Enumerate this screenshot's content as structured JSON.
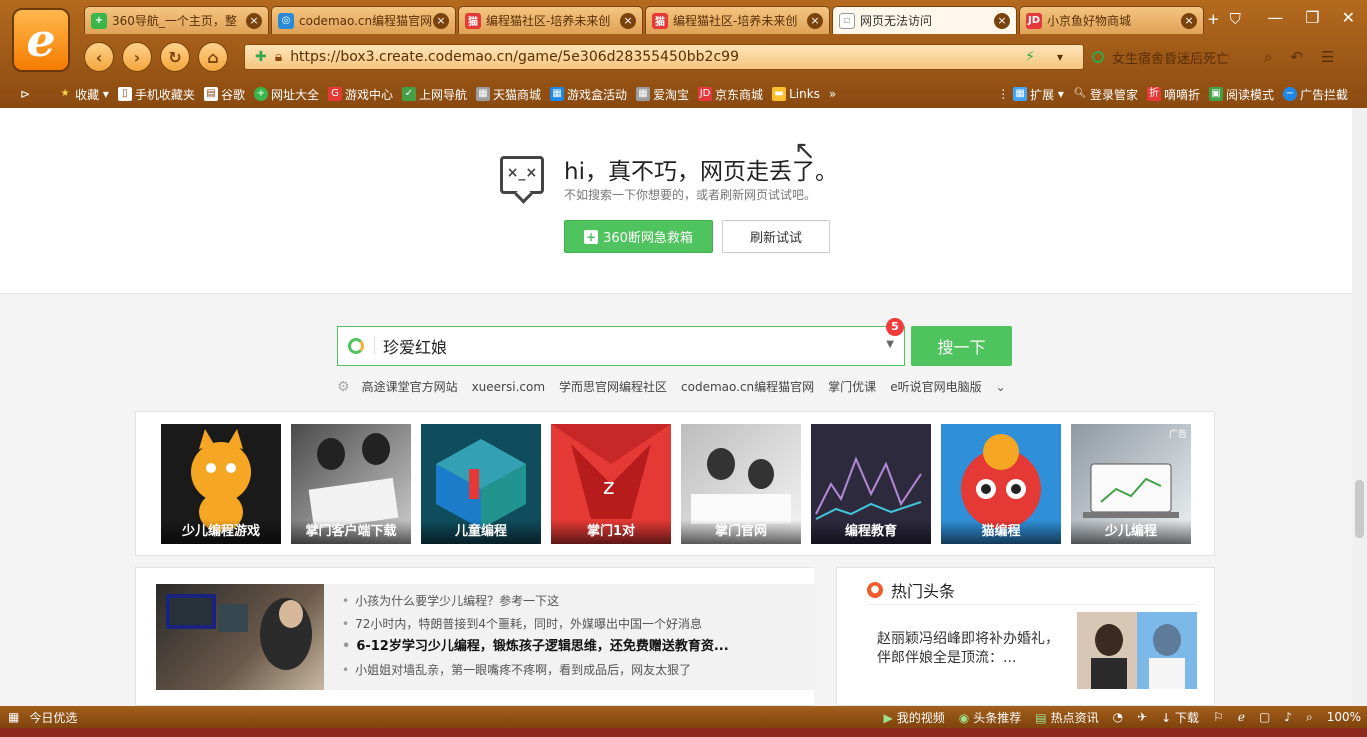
{
  "tabs": [
    {
      "title": "360导航_一个主页，整",
      "icon": "360-icon",
      "color": "#3ab54a"
    },
    {
      "title": "codemao.cn编程猫官网",
      "icon": "globe-icon",
      "color": "#2b8ad8"
    },
    {
      "title": "编程猫社区-培养未来创",
      "icon": "codemao-icon",
      "color": "#e53935"
    },
    {
      "title": "编程猫社区-培养未来创",
      "icon": "codemao-icon",
      "color": "#e53935"
    },
    {
      "title": "网页无法访问",
      "icon": "page-icon",
      "color": "#999999"
    },
    {
      "title": "小京鱼好物商城",
      "icon": "jd-icon",
      "color": "#e4393c"
    }
  ],
  "address": {
    "url": "https://box3.create.codemao.cn/game/5e306d28355450bb2c99",
    "search_hint": "女生宿舍昏迷后死亡"
  },
  "bookmarks": {
    "items": [
      "收藏",
      "手机收藏夹",
      "谷歌",
      "网址大全",
      "游戏中心",
      "上网导航",
      "天猫商城",
      "游戏盒活动",
      "爱淘宝",
      "京东商城",
      "Links"
    ],
    "right": [
      "扩展",
      "登录管家",
      "嘀嘀折",
      "阅读模式",
      "广告拦截"
    ]
  },
  "error": {
    "face": "×_×",
    "title": "hi，真不巧，网页走丢了。",
    "subtitle": "不如搜索一下你想要的，或者刷新网页试试吧。",
    "rescue_label": "360断网急救箱",
    "refresh_label": "刷新试试"
  },
  "search": {
    "value": "珍爱红娘",
    "badge": "5",
    "button": "搜一下",
    "hotwords": [
      "高途课堂官方网站",
      "xueersi.com",
      "学而思官网编程社区",
      "codemao.cn编程猫官网",
      "掌门优课",
      "e听说官网电脑版"
    ]
  },
  "tiles": [
    {
      "label": "少儿编程游戏",
      "bg": "#1a1a1a",
      "accent": "#f5a623"
    },
    {
      "label": "掌门客户端下载",
      "bg": "#6b6b6b",
      "accent": "#e0e0e0"
    },
    {
      "label": "儿童编程",
      "bg": "#0f4c5c",
      "accent": "#43c6d9"
    },
    {
      "label": "掌门1对",
      "bg": "#c62828",
      "accent": "#ef5350"
    },
    {
      "label": "掌门官网",
      "bg": "#9e9e9e",
      "accent": "#e8e8e8"
    },
    {
      "label": "编程教育",
      "bg": "#2d2a3e",
      "accent": "#b48ad8"
    },
    {
      "label": "猫编程",
      "bg": "#2f8fd8",
      "accent": "#e53935"
    },
    {
      "label": "少儿编程",
      "bg": "#b0b8bf",
      "accent": "#e8ecef",
      "ad": "广告"
    }
  ],
  "news": [
    {
      "text": "小孩为什么要学少儿编程？参考一下这",
      "strong": false
    },
    {
      "text": "72小时内，特朗普接到4个噩耗，同时，外媒曝出中国一个好消息",
      "strong": false
    },
    {
      "text": "6-12岁学习少儿编程，锻炼孩子逻辑思维，还免费赠送教育资...",
      "strong": true
    },
    {
      "text": "小姐姐对墙乱亲，第一眼嘴疼不疼啊，看到成品后，网友太狠了",
      "strong": false
    }
  ],
  "hot": {
    "heading": "热门头条",
    "text": "赵丽颖冯绍峰即将补办婚礼，伴郎伴娘全是顶流：..."
  },
  "status": {
    "left": "今日优选",
    "right": [
      "我的视频",
      "头条推荐",
      "热点资讯",
      "下载",
      "100%"
    ]
  }
}
